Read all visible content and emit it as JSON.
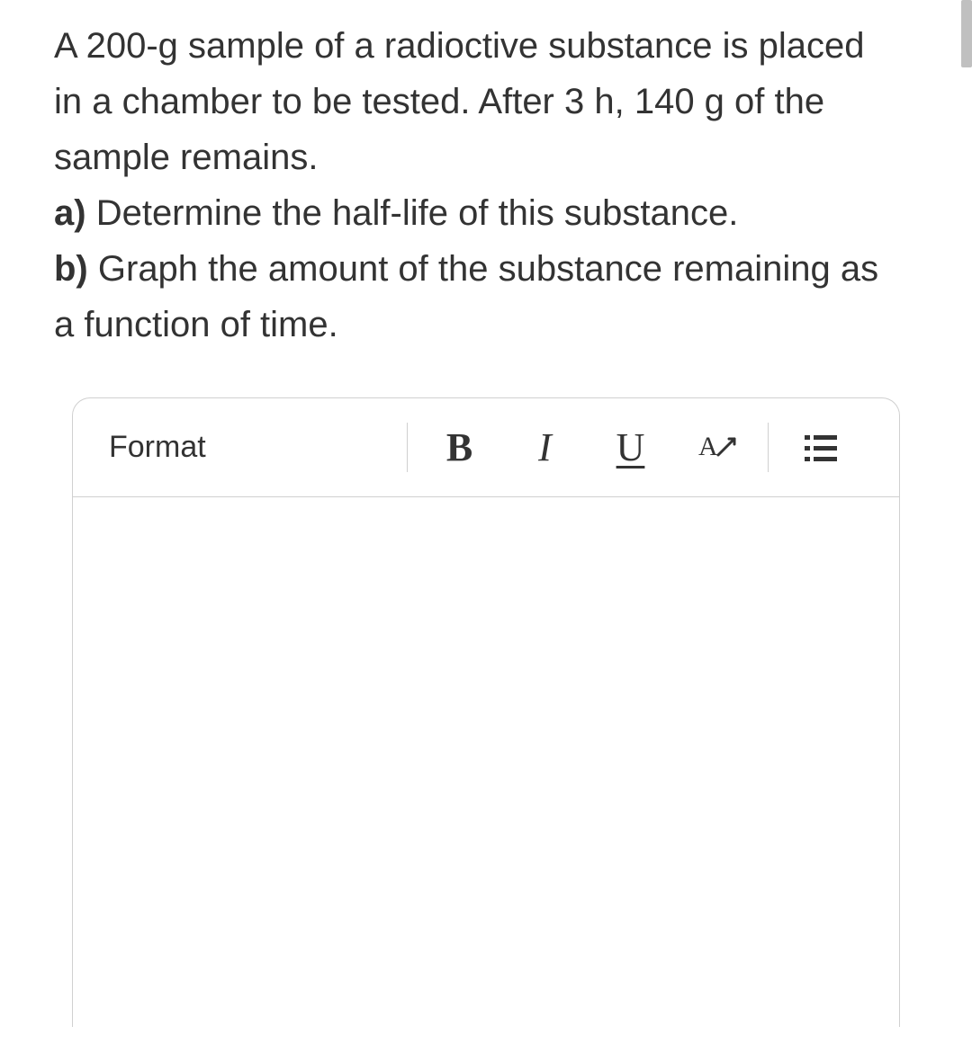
{
  "question": {
    "intro": "A 200-g sample of a radioctive substance is placed in a chamber to be tested. After 3 h, 140 g of the sample remains.",
    "part_a_label": "a)",
    "part_a_text": " Determine the half-life of this substance.",
    "part_b_label": "b)",
    "part_b_text": " Graph the amount of the substance remaining as a function of time."
  },
  "toolbar": {
    "format_label": "Format",
    "bold_label": "B",
    "italic_label": "I",
    "underline_label": "U"
  }
}
